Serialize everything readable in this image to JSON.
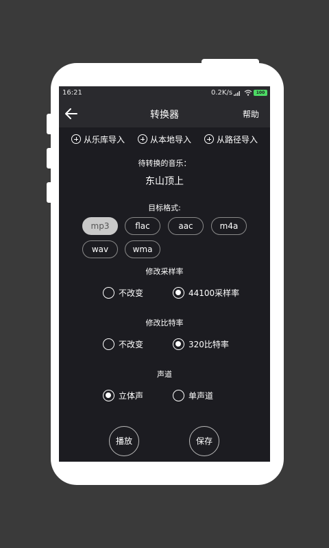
{
  "status": {
    "time": "16:21",
    "speed": "0.2K/s",
    "battery": "100"
  },
  "appbar": {
    "title": "转换器",
    "help": "帮助",
    "back_icon": "arrow-left-icon"
  },
  "imports": [
    "从乐库导入",
    "从本地导入",
    "从路径导入"
  ],
  "source": {
    "label": "待转换的音乐：",
    "song": "东山顶上"
  },
  "format": {
    "label": "目标格式:",
    "options": [
      "mp3",
      "flac",
      "aac",
      "m4a",
      "wav",
      "wma"
    ],
    "selected": "mp3"
  },
  "sample_rate": {
    "label": "修改采样率",
    "options": [
      "不改变",
      "44100采样率"
    ],
    "selected": "44100采样率"
  },
  "bit_rate": {
    "label": "修改比特率",
    "options": [
      "不改变",
      "320比特率"
    ],
    "selected": "320比特率"
  },
  "channel": {
    "label": "声道",
    "options": [
      "立体声",
      "单声道"
    ],
    "selected": "立体声"
  },
  "actions": {
    "play": "播放",
    "save": "保存"
  },
  "colors": {
    "background": "#3a3a3a",
    "screen": "#1c1c21",
    "appbar": "#2a2a2e",
    "chip_active": "#c9c9c9",
    "battery": "#4cd964"
  }
}
